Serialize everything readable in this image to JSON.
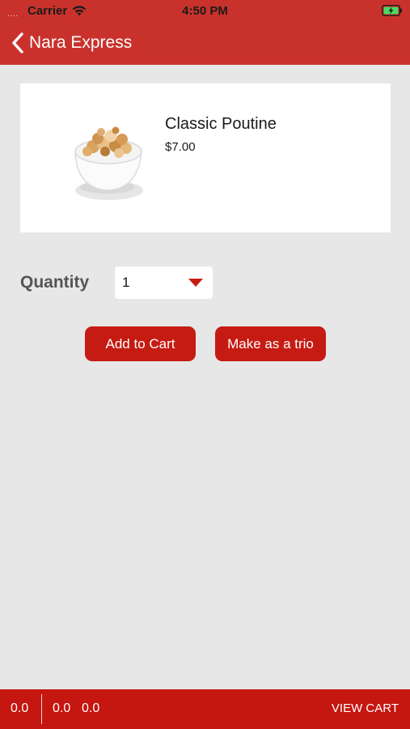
{
  "status_bar": {
    "signal": "....",
    "carrier": "Carrier",
    "time": "4:50 PM"
  },
  "nav": {
    "back_label": "Nara Express"
  },
  "product": {
    "name": "Classic Poutine",
    "price": "$7.00"
  },
  "quantity": {
    "label": "Quantity",
    "value": "1"
  },
  "actions": {
    "add_to_cart": "Add to Cart",
    "make_trio": "Make as a trio"
  },
  "bottom_bar": {
    "value_1": "0.0",
    "value_2": "0.0",
    "value_3": "0.0",
    "view_cart": "VIEW CART"
  },
  "colors": {
    "header": "#c9322c",
    "button": "#c51b13",
    "bottom_bar": "#c5160f",
    "background": "#e7e7e7"
  }
}
